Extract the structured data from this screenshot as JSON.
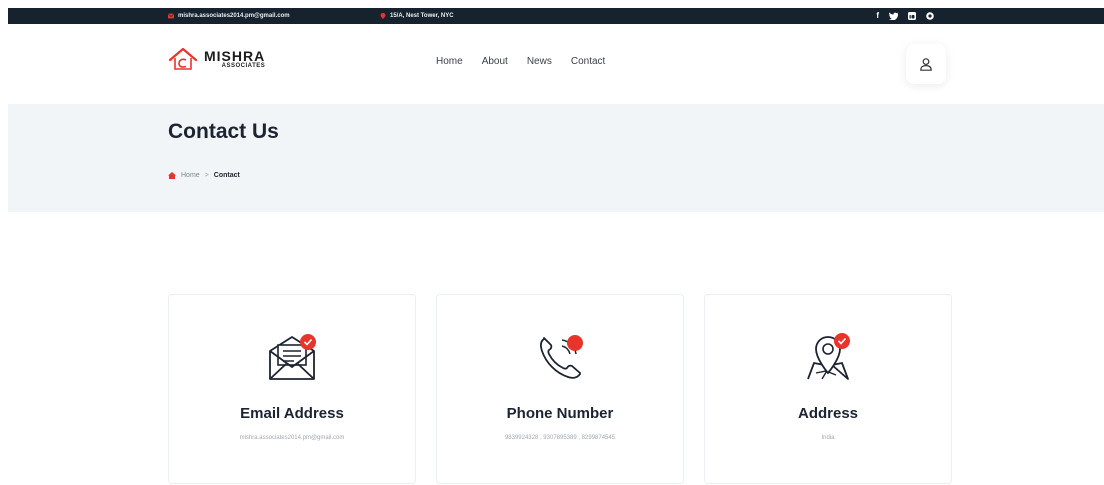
{
  "topbar": {
    "email": "mishra.associates2014.pm@gmail.com",
    "address": "15/A, Nest Tower, NYC",
    "social": [
      "f",
      "t",
      "in",
      "ig"
    ]
  },
  "header": {
    "logo_name": "MISHRA",
    "logo_sub": "ASSOCIATES",
    "nav": [
      "Home",
      "About",
      "News",
      "Contact"
    ]
  },
  "hero": {
    "title": "Contact Us",
    "breadcrumb_home": "Home",
    "breadcrumb_sep": ">",
    "breadcrumb_current": "Contact"
  },
  "cards": [
    {
      "icon": "envelope-icon",
      "title": "Email Address",
      "value": "mishra.associates2014.pm@gmail.com"
    },
    {
      "icon": "phone-icon",
      "title": "Phone Number",
      "value": "9839924328 , 9307895389 , 8299874545"
    },
    {
      "icon": "map-pin-icon",
      "title": "Address",
      "value": "India"
    }
  ],
  "colors": {
    "accent": "#e8352b",
    "topbar": "#16232f",
    "hero_bg": "#f2f5f8"
  }
}
